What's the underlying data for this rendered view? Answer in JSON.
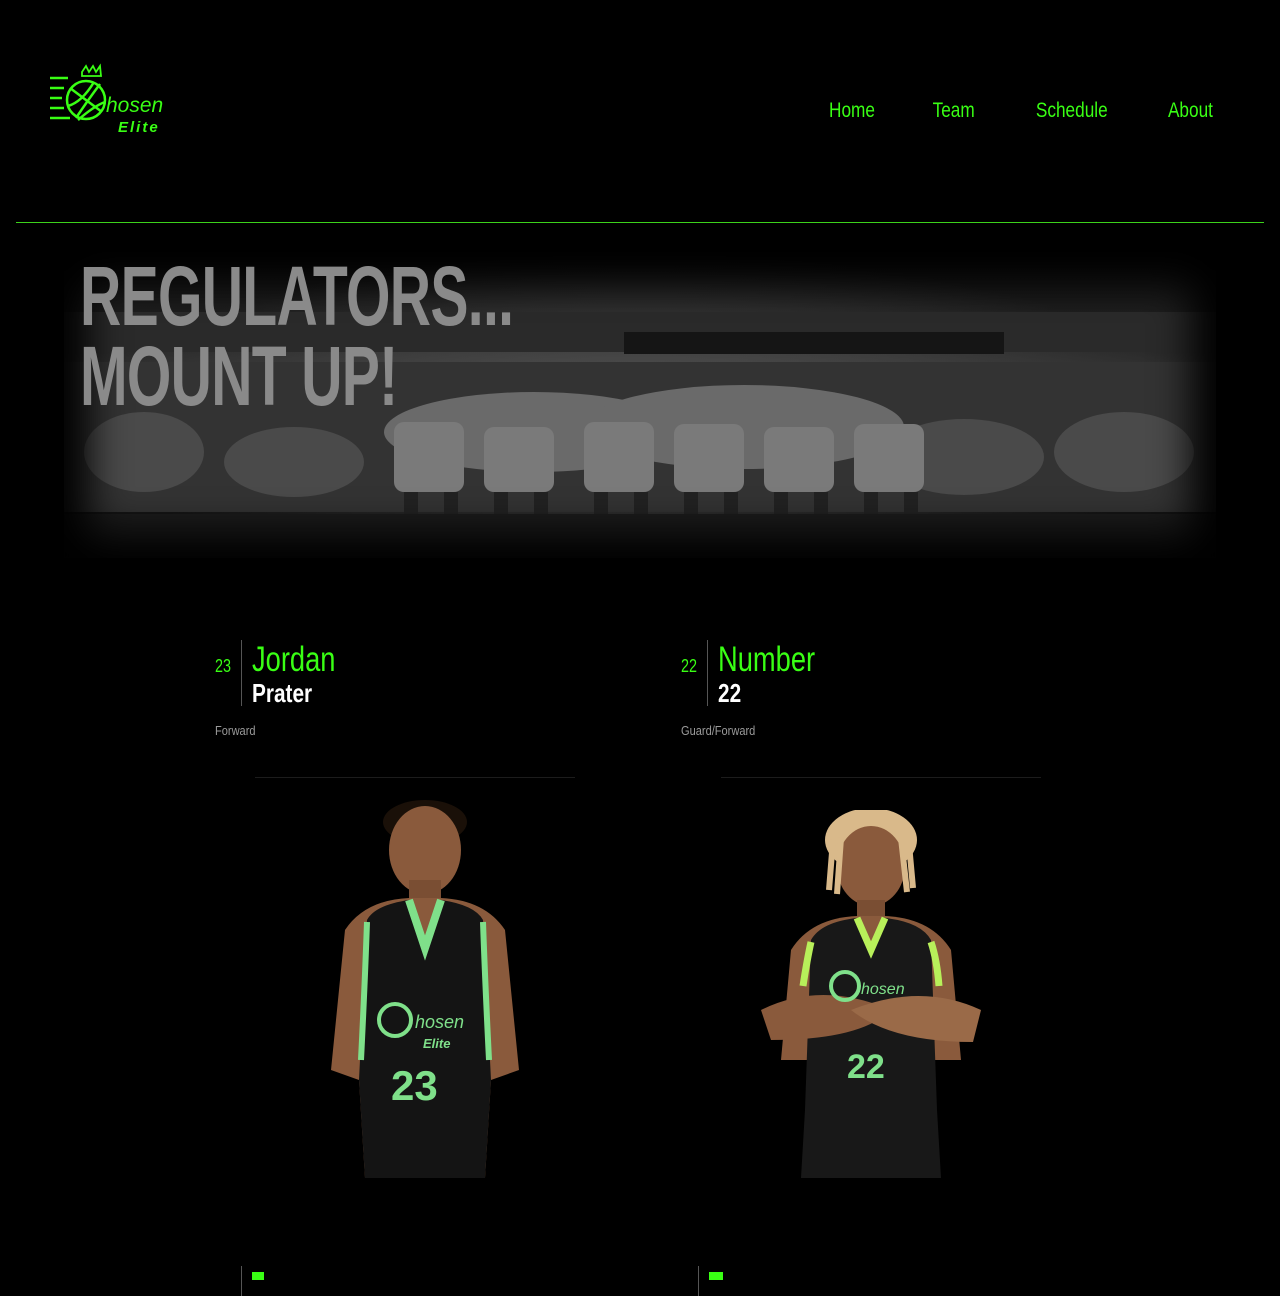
{
  "brand": {
    "logo_top": "hosen",
    "logo_bottom": "Elite"
  },
  "nav": {
    "items": [
      {
        "label": "Home"
      },
      {
        "label": "Team"
      },
      {
        "label": "Schedule"
      },
      {
        "label": "About"
      }
    ]
  },
  "hero": {
    "line1": "REGULATORS...",
    "line2": "MOUNT UP!"
  },
  "players": [
    {
      "number": "23",
      "first": "Jordan",
      "last": "Prater",
      "position": "Forward",
      "jersey": "23"
    },
    {
      "number": "22",
      "first": "Number",
      "last": "22",
      "position": "Guard/Forward",
      "jersey": "22"
    }
  ],
  "colors": {
    "accent": "#39ff14",
    "background": "#000000",
    "jersey_trim": "#7fe08a"
  },
  "icons": {
    "logo": "basketball-crown-logo"
  }
}
